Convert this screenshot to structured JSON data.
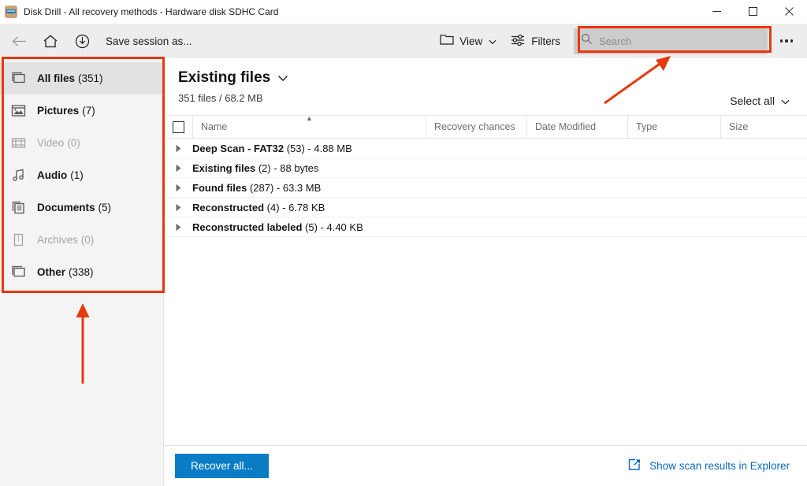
{
  "window": {
    "title": "Disk Drill - All recovery methods - Hardware disk SDHC Card",
    "app_icon": "disk-drill-icon",
    "minimize_label": "Minimize",
    "maximize_label": "Maximize",
    "close_label": "Close"
  },
  "toolbar": {
    "back_label": "Back",
    "home_label": "Home",
    "save_session_label": "Save session as...",
    "view_label": "View",
    "filters_label": "Filters",
    "more_label": "More options",
    "search": {
      "placeholder": "Search",
      "value": "",
      "icon": "search-icon"
    }
  },
  "sidebar": {
    "items": [
      {
        "label": "All files",
        "count": "(351)",
        "icon": "all-files-icon",
        "selected": true,
        "disabled": false
      },
      {
        "label": "Pictures",
        "count": "(7)",
        "icon": "pictures-icon",
        "selected": false,
        "disabled": false
      },
      {
        "label": "Video",
        "count": "(0)",
        "icon": "video-icon",
        "selected": false,
        "disabled": true
      },
      {
        "label": "Audio",
        "count": "(1)",
        "icon": "audio-icon",
        "selected": false,
        "disabled": false
      },
      {
        "label": "Documents",
        "count": "(5)",
        "icon": "documents-icon",
        "selected": false,
        "disabled": false
      },
      {
        "label": "Archives",
        "count": "(0)",
        "icon": "archives-icon",
        "selected": false,
        "disabled": true
      },
      {
        "label": "Other",
        "count": "(338)",
        "icon": "other-icon",
        "selected": false,
        "disabled": false
      }
    ]
  },
  "main": {
    "title": "Existing files",
    "subtitle": "351 files / 68.2 MB",
    "select_all_label": "Select all",
    "columns": [
      {
        "label": "Name",
        "sorted": "asc"
      },
      {
        "label": "Recovery chances",
        "sorted": ""
      },
      {
        "label": "Date Modified",
        "sorted": ""
      },
      {
        "label": "Type",
        "sorted": ""
      },
      {
        "label": "Size",
        "sorted": ""
      }
    ],
    "rows": [
      {
        "label": "Deep Scan - FAT32",
        "meta": " (53) - 4.88 MB",
        "expanded": false
      },
      {
        "label": "Existing files",
        "meta": " (2) - 88 bytes",
        "expanded": false
      },
      {
        "label": "Found files",
        "meta": " (287) - 63.3 MB",
        "expanded": false
      },
      {
        "label": "Reconstructed",
        "meta": " (4) - 6.78 KB",
        "expanded": false
      },
      {
        "label": "Reconstructed labeled",
        "meta": " (5) - 4.40 KB",
        "expanded": false
      }
    ]
  },
  "footer": {
    "recover_label": "Recover all...",
    "explorer_link_label": "Show scan results in Explorer",
    "explorer_icon": "open-external-icon"
  },
  "annotations": {
    "highlight_color": "#e8380d",
    "sidebar_box": "highlights file category list",
    "search_box": "highlights search field",
    "arrow_up": "points to sidebar category list",
    "arrow_diagonal": "points to search field"
  },
  "colors": {
    "accent_blue": "#0a7cc6",
    "link_blue": "#0a69b7",
    "annotation_red": "#e8380d",
    "toolbar_bg": "#ededed",
    "sidebar_bg": "#f4f4f4",
    "search_bg": "#cccccc"
  }
}
